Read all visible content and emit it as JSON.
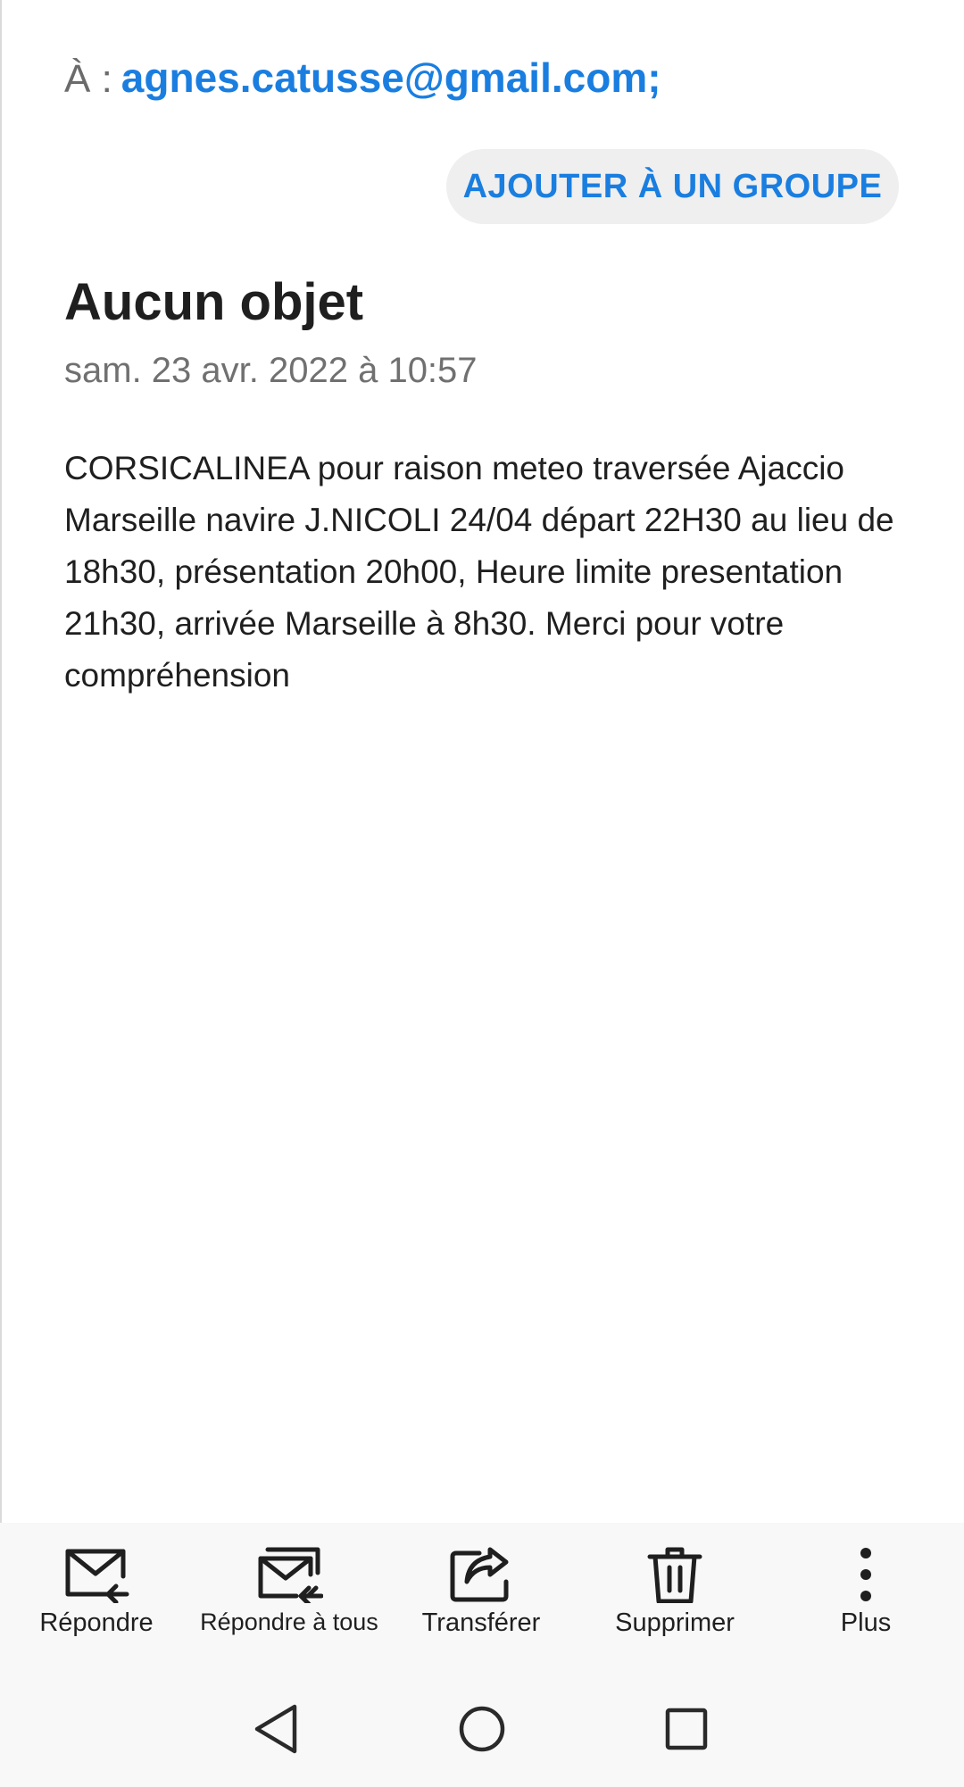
{
  "recipient": {
    "label": "À :",
    "address": "agnes.catusse@gmail.com;"
  },
  "add_group_button": "AJOUTER À UN GROUPE",
  "message": {
    "subject": "Aucun objet",
    "date": "sam. 23 avr. 2022 à 10:57",
    "body": "CORSICALINEA pour raison meteo traversée Ajaccio Marseille navire J.NICOLI 24/04 départ 22H30 au lieu de 18h30, présentation 20h00, Heure limite presentation 21h30, arrivée Marseille à 8h30. Merci pour votre compréhension"
  },
  "toolbar": {
    "reply": "Répondre",
    "reply_all": "Répondre à tous",
    "forward": "Transférer",
    "delete": "Supprimer",
    "more": "Plus"
  },
  "icons": {
    "reply": "reply-mail-icon",
    "reply_all": "reply-all-mail-icon",
    "forward": "forward-icon",
    "delete": "trash-icon",
    "more": "more-vertical-icon",
    "back": "nav-back-icon",
    "home": "nav-home-icon",
    "recents": "nav-recents-icon"
  },
  "colors": {
    "accent": "#1a7ee0",
    "toolbar_bg": "#f8f8f8",
    "chip_bg": "#efefef"
  }
}
